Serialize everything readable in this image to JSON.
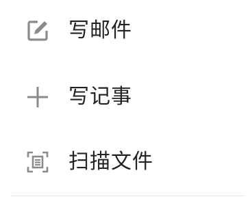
{
  "menu": {
    "items": [
      {
        "label": "写邮件",
        "icon": "compose-icon"
      },
      {
        "label": "写记事",
        "icon": "plus-icon"
      },
      {
        "label": "扫描文件",
        "icon": "scan-document-icon"
      }
    ]
  },
  "colors": {
    "icon": "#8a8a8a",
    "text": "#222222",
    "divider": "#e6e6e6",
    "background": "#ffffff"
  }
}
